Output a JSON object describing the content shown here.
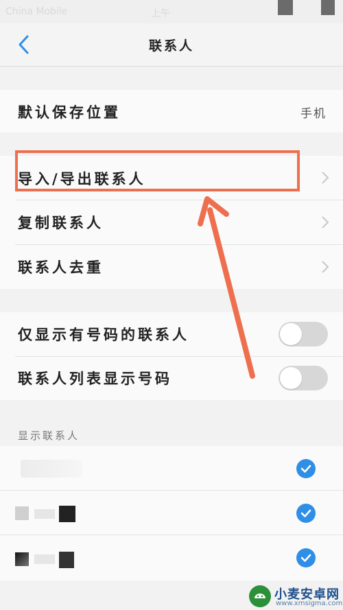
{
  "status_bar": {
    "left_text": "China Mobile",
    "center_text": "上午"
  },
  "nav": {
    "title": "联系人",
    "back_icon": "chevron-left-icon"
  },
  "storage": {
    "label": "默认保存位置",
    "value": "手机"
  },
  "manage": {
    "items": [
      {
        "label": "导入/导出联系人",
        "icon": "chevron-right-icon"
      },
      {
        "label": "复制联系人",
        "icon": "chevron-right-icon"
      },
      {
        "label": "联系人去重",
        "icon": "chevron-right-icon"
      }
    ]
  },
  "display_options": {
    "items": [
      {
        "label": "仅显示有号码的联系人",
        "enabled": false
      },
      {
        "label": "联系人列表显示号码",
        "enabled": false
      }
    ]
  },
  "accounts": {
    "header": "显示联系人",
    "items": [
      {
        "checked": true,
        "icon": "check-icon"
      },
      {
        "checked": true,
        "icon": "check-icon"
      },
      {
        "checked": true,
        "icon": "check-icon"
      }
    ]
  },
  "annotation": {
    "highlight_color": "#ee6f4e",
    "arrow_color": "#ee6f4e"
  },
  "watermark": {
    "name": "小麦安卓网",
    "url": "www.xmsigma.com"
  },
  "colors": {
    "accent": "#2f8ee6",
    "toggle_off": "#d7d7d7"
  }
}
